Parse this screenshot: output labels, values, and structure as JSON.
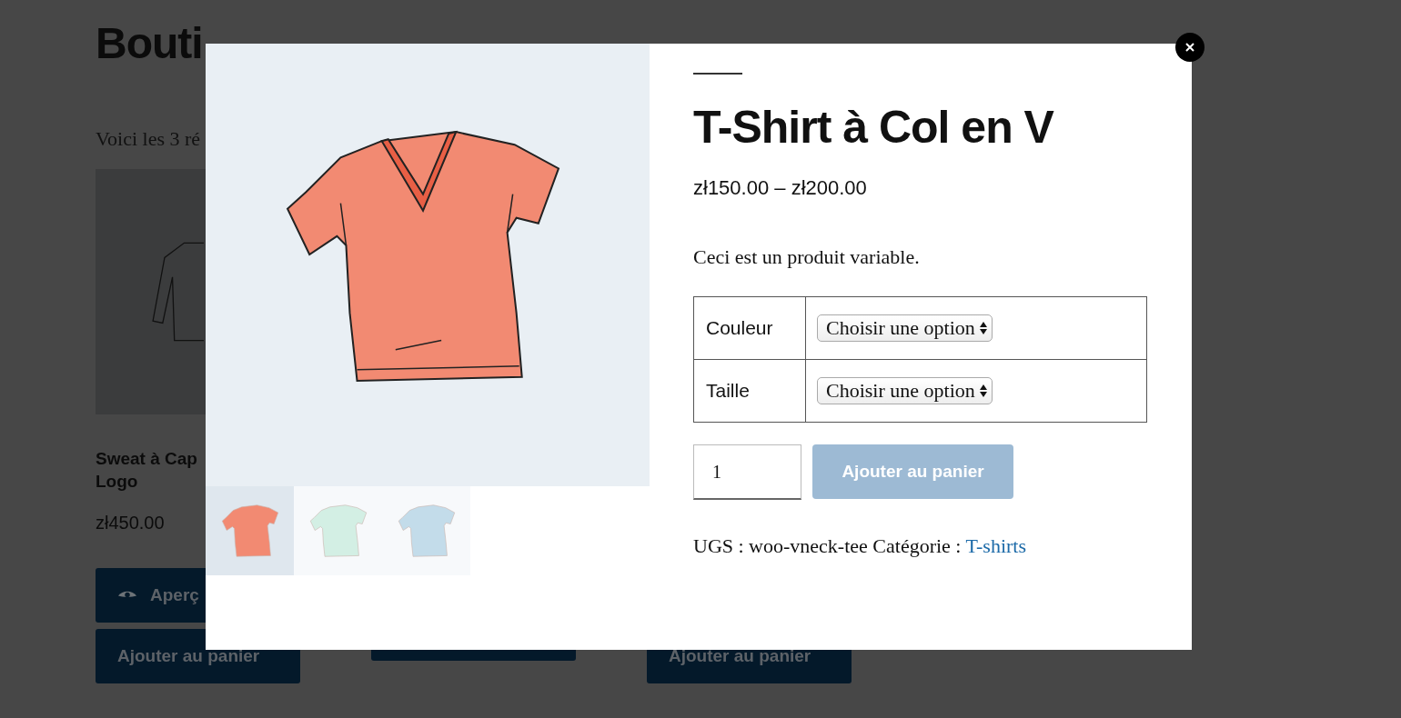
{
  "page": {
    "heading": "Bouti",
    "intro": "Voici les 3 ré",
    "products": [
      {
        "name_lines": [
          "Sweat à Cap",
          "Logo"
        ],
        "price": "zł450.00",
        "image": true,
        "buttons": [
          {
            "kind": "preview",
            "label": "Aperç"
          },
          {
            "kind": "cart",
            "label": "Ajouter au panier"
          }
        ]
      },
      {
        "image": false,
        "buttons": [
          {
            "kind": "cart"
          }
        ]
      },
      {
        "image": false,
        "buttons": [
          {
            "kind": "cart",
            "label": "Ajouter au panier"
          }
        ]
      }
    ]
  },
  "modal": {
    "gallery": {
      "thumbnails": [
        {
          "color": "#f28a72",
          "selected": true
        },
        {
          "color": "#d3efe4",
          "selected": false
        },
        {
          "color": "#c3dcea",
          "selected": false
        }
      ]
    },
    "title": "T-Shirt à Col en V",
    "price": "zł150.00 – zł200.00",
    "description": "Ceci est un produit variable.",
    "attributes": [
      {
        "label": "Couleur",
        "value": "Choisir une option"
      },
      {
        "label": "Taille",
        "value": "Choisir une option"
      }
    ],
    "quantity": "1",
    "add_button": {
      "label": "Ajouter au panier",
      "disabled": true
    },
    "meta": {
      "sku_label": "UGS :",
      "sku": "woo-vneck-tee",
      "category_label": "Catégorie :",
      "category": "T-shirts"
    }
  }
}
